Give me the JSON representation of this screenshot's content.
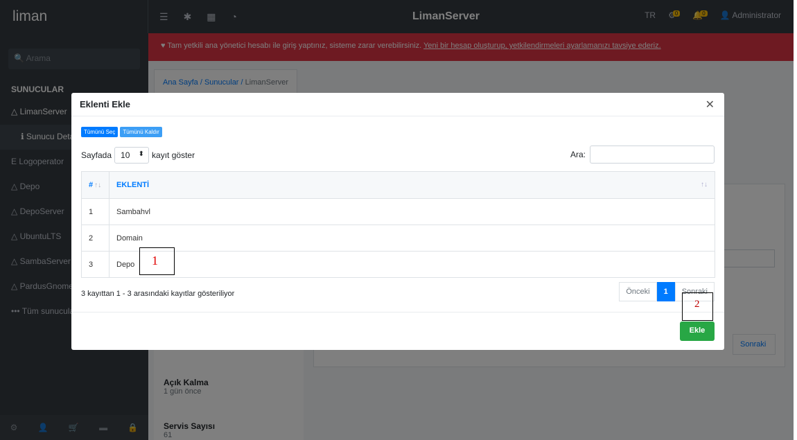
{
  "app": {
    "brand": "liman",
    "title": "LimanServer",
    "language": "TR",
    "user": "Administrator",
    "notif_badge_1": "0",
    "notif_badge_2": "0",
    "top_icons": [
      "menu-icon",
      "asterisk-icon",
      "grid-icon",
      "pie-chart-icon"
    ]
  },
  "sidebar": {
    "search_placeholder": "Arama",
    "header": "SUNUCULAR",
    "items": [
      {
        "label": "LimanServer"
      },
      {
        "label": "Sunucu Detayları"
      },
      {
        "label": "Logoperator"
      },
      {
        "label": "Depo"
      },
      {
        "label": "DepoServer"
      },
      {
        "label": "UbuntuLTS"
      },
      {
        "label": "SambaServer"
      },
      {
        "label": "PardusGnome"
      },
      {
        "label": "Tüm sunucular"
      }
    ]
  },
  "alert": {
    "text": "Tam yetkili ana yönetici hesabı ile giriş yaptınız, sisteme zarar verebilirsiniz.",
    "link": "Yeni bir hesap oluşturup, yetkilendirmeleri ayarlamanızı tavsiye ederiz."
  },
  "breadcrumb": {
    "home": "Ana Sayfa",
    "servers": "Sunucular",
    "current": "LimanServer"
  },
  "server_stats": {
    "uptime_label": "Açık Kalma",
    "uptime_value": "1 gün önce",
    "service_label": "Servis Sayısı",
    "service_value": "61"
  },
  "background": {
    "next_label": "Sonraki"
  },
  "modal": {
    "title": "Eklenti Ekle",
    "select_all": "Tümünü Seç",
    "deselect_all": "Tümünü Kaldır",
    "length_prefix": "Sayfada",
    "length_value": "10",
    "length_suffix": "kayıt göster",
    "search_label": "Ara:",
    "columns": [
      "#",
      "EKLENTİ"
    ],
    "rows": [
      {
        "num": "1",
        "name": "Sambahvl"
      },
      {
        "num": "2",
        "name": "Domain"
      },
      {
        "num": "3",
        "name": "Depo"
      }
    ],
    "info": "3 kayıttan 1 - 3 arasındaki kayıtlar gösteriliyor",
    "prev": "Önceki",
    "page": "1",
    "next": "Sonraki",
    "add": "Ekle"
  },
  "annotations": {
    "marker1": "1",
    "marker2": "2",
    "marker1_color": "#e00000",
    "marker2_color": "#c00000"
  }
}
